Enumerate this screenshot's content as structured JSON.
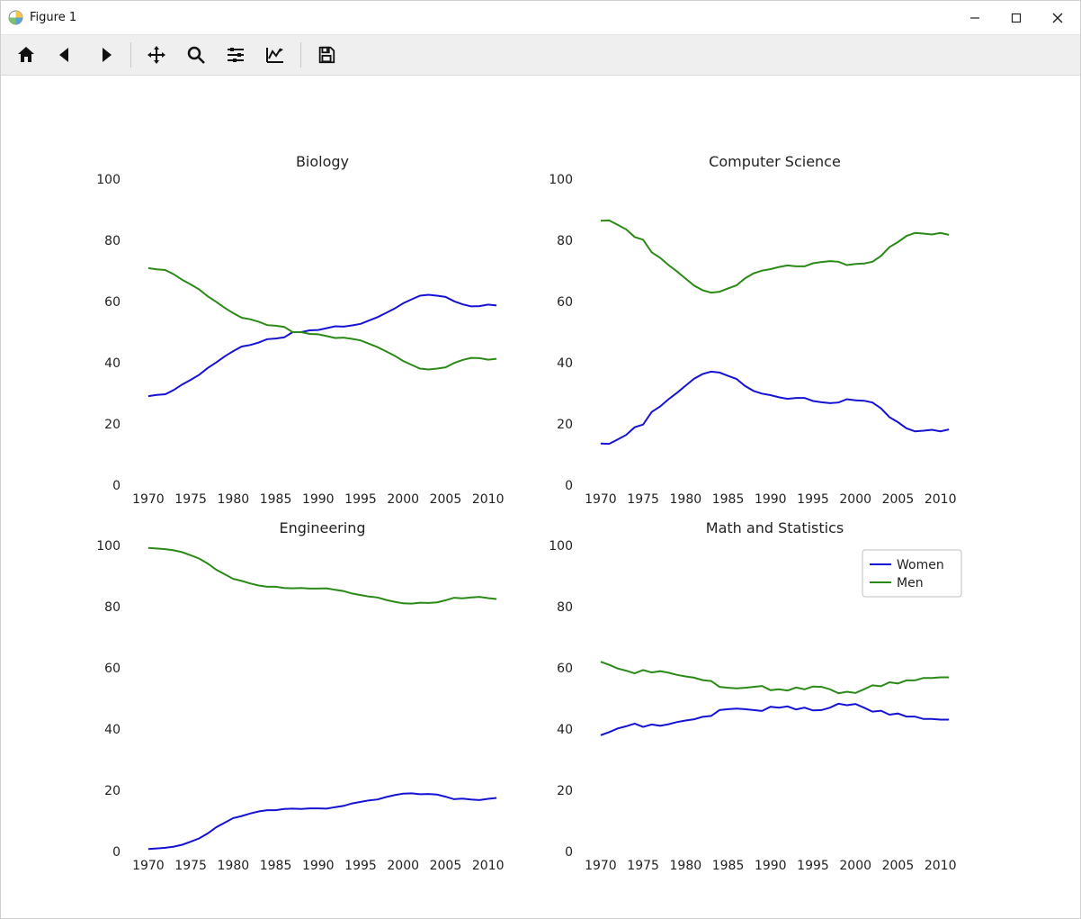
{
  "window": {
    "title": "Figure 1"
  },
  "toolbar": {
    "home": "Home",
    "back": "Back",
    "forward": "Forward",
    "pan": "Pan",
    "zoom": "Zoom",
    "subplots": "Configure subplots",
    "editor": "Edit axis",
    "save": "Save"
  },
  "colors": {
    "women": "#1512d4",
    "men": "#2b8a17"
  },
  "legend": [
    "Women",
    "Men"
  ],
  "chart_data": [
    {
      "type": "line",
      "title": "Biology",
      "xlabel": "",
      "ylabel": "",
      "x_ticks": [
        1970,
        1975,
        1980,
        1985,
        1990,
        1995,
        2000,
        2005,
        2010
      ],
      "y_ticks": [
        0,
        20,
        40,
        60,
        80,
        100
      ],
      "xlim": [
        1968,
        2013
      ],
      "ylim": [
        0,
        100
      ],
      "show_legend": false,
      "x": [
        1970,
        1971,
        1972,
        1973,
        1974,
        1975,
        1976,
        1977,
        1978,
        1979,
        1980,
        1981,
        1982,
        1983,
        1984,
        1985,
        1986,
        1987,
        1988,
        1989,
        1990,
        1991,
        1992,
        1993,
        1994,
        1995,
        1996,
        1997,
        1998,
        1999,
        2000,
        2001,
        2002,
        2003,
        2004,
        2005,
        2006,
        2007,
        2008,
        2009,
        2010,
        2011
      ],
      "series": [
        {
          "name": "Women",
          "color_key": "women",
          "values": [
            29.1,
            29.5,
            29.7,
            31.1,
            32.9,
            34.4,
            36.1,
            38.3,
            40.1,
            42.1,
            43.8,
            45.3,
            45.8,
            46.6,
            47.7,
            47.9,
            48.3,
            50.0,
            50.0,
            50.6,
            50.7,
            51.3,
            51.9,
            51.8,
            52.2,
            52.7,
            53.8,
            54.9,
            56.3,
            57.7,
            59.4,
            60.7,
            61.9,
            62.2,
            61.9,
            61.5,
            60.1,
            59.1,
            58.4,
            58.5,
            59.0,
            58.7
          ]
        },
        {
          "name": "Men",
          "color_key": "men",
          "values": [
            70.9,
            70.5,
            70.3,
            68.9,
            67.1,
            65.6,
            63.9,
            61.7,
            59.9,
            57.9,
            56.2,
            54.7,
            54.2,
            53.4,
            52.3,
            52.1,
            51.7,
            50.0,
            50.0,
            49.4,
            49.3,
            48.7,
            48.1,
            48.2,
            47.8,
            47.3,
            46.2,
            45.1,
            43.7,
            42.3,
            40.6,
            39.3,
            38.1,
            37.8,
            38.1,
            38.5,
            39.9,
            40.9,
            41.6,
            41.5,
            41.0,
            41.3
          ]
        }
      ]
    },
    {
      "type": "line",
      "title": "Computer Science",
      "xlabel": "",
      "ylabel": "",
      "x_ticks": [
        1970,
        1975,
        1980,
        1985,
        1990,
        1995,
        2000,
        2005,
        2010
      ],
      "y_ticks": [
        0,
        20,
        40,
        60,
        80,
        100
      ],
      "xlim": [
        1968,
        2013
      ],
      "ylim": [
        0,
        100
      ],
      "show_legend": false,
      "x": [
        1970,
        1971,
        1972,
        1973,
        1974,
        1975,
        1976,
        1977,
        1978,
        1979,
        1980,
        1981,
        1982,
        1983,
        1984,
        1985,
        1986,
        1987,
        1988,
        1989,
        1990,
        1991,
        1992,
        1993,
        1994,
        1995,
        1996,
        1997,
        1998,
        1999,
        2000,
        2001,
        2002,
        2003,
        2004,
        2005,
        2006,
        2007,
        2008,
        2009,
        2010,
        2011
      ],
      "series": [
        {
          "name": "Women",
          "color_key": "women",
          "values": [
            13.6,
            13.5,
            14.9,
            16.4,
            18.9,
            19.8,
            23.9,
            25.7,
            28.1,
            30.2,
            32.5,
            34.8,
            36.3,
            37.1,
            36.8,
            35.7,
            34.7,
            32.4,
            30.8,
            29.9,
            29.4,
            28.7,
            28.2,
            28.5,
            28.5,
            27.5,
            27.1,
            26.8,
            27.0,
            28.1,
            27.7,
            27.6,
            27.0,
            25.1,
            22.2,
            20.6,
            18.6,
            17.6,
            17.8,
            18.1,
            17.6,
            18.2
          ]
        },
        {
          "name": "Men",
          "color_key": "men",
          "values": [
            86.4,
            86.5,
            85.1,
            83.6,
            81.1,
            80.2,
            76.1,
            74.3,
            71.9,
            69.8,
            67.5,
            65.2,
            63.7,
            62.9,
            63.2,
            64.3,
            65.3,
            67.6,
            69.2,
            70.1,
            70.6,
            71.3,
            71.8,
            71.5,
            71.5,
            72.5,
            72.9,
            73.2,
            73.0,
            71.9,
            72.3,
            72.4,
            73.0,
            74.9,
            77.8,
            79.4,
            81.4,
            82.4,
            82.2,
            81.9,
            82.4,
            81.8
          ]
        }
      ]
    },
    {
      "type": "line",
      "title": "Engineering",
      "xlabel": "",
      "ylabel": "",
      "x_ticks": [
        1970,
        1975,
        1980,
        1985,
        1990,
        1995,
        2000,
        2005,
        2010
      ],
      "y_ticks": [
        0,
        20,
        40,
        60,
        80,
        100
      ],
      "xlim": [
        1968,
        2013
      ],
      "ylim": [
        0,
        100
      ],
      "show_legend": false,
      "x": [
        1970,
        1971,
        1972,
        1973,
        1974,
        1975,
        1976,
        1977,
        1978,
        1979,
        1980,
        1981,
        1982,
        1983,
        1984,
        1985,
        1986,
        1987,
        1988,
        1989,
        1990,
        1991,
        1992,
        1993,
        1994,
        1995,
        1996,
        1997,
        1998,
        1999,
        2000,
        2001,
        2002,
        2003,
        2004,
        2005,
        2006,
        2007,
        2008,
        2009,
        2010,
        2011
      ],
      "series": [
        {
          "name": "Women",
          "color_key": "women",
          "values": [
            0.8,
            1.0,
            1.2,
            1.6,
            2.2,
            3.2,
            4.3,
            5.9,
            7.9,
            9.4,
            10.9,
            11.6,
            12.4,
            13.1,
            13.5,
            13.5,
            13.9,
            14.0,
            13.9,
            14.1,
            14.1,
            14.0,
            14.5,
            14.9,
            15.7,
            16.2,
            16.7,
            17.0,
            17.8,
            18.4,
            18.9,
            19.0,
            18.7,
            18.8,
            18.6,
            17.9,
            17.1,
            17.3,
            17.0,
            16.8,
            17.2,
            17.5
          ]
        },
        {
          "name": "Men",
          "color_key": "men",
          "values": [
            99.2,
            99.0,
            98.8,
            98.4,
            97.8,
            96.8,
            95.7,
            94.1,
            92.1,
            90.6,
            89.1,
            88.4,
            87.6,
            86.9,
            86.5,
            86.5,
            86.1,
            86.0,
            86.1,
            85.9,
            85.9,
            86.0,
            85.5,
            85.1,
            84.3,
            83.8,
            83.3,
            83.0,
            82.2,
            81.6,
            81.1,
            81.0,
            81.3,
            81.2,
            81.4,
            82.1,
            82.9,
            82.7,
            83.0,
            83.2,
            82.8,
            82.5
          ]
        }
      ]
    },
    {
      "type": "line",
      "title": "Math and Statistics",
      "xlabel": "",
      "ylabel": "",
      "x_ticks": [
        1970,
        1975,
        1980,
        1985,
        1990,
        1995,
        2000,
        2005,
        2010
      ],
      "y_ticks": [
        0,
        20,
        40,
        60,
        80,
        100
      ],
      "xlim": [
        1968,
        2013
      ],
      "ylim": [
        0,
        100
      ],
      "show_legend": true,
      "x": [
        1970,
        1971,
        1972,
        1973,
        1974,
        1975,
        1976,
        1977,
        1978,
        1979,
        1980,
        1981,
        1982,
        1983,
        1984,
        1985,
        1986,
        1987,
        1988,
        1989,
        1990,
        1991,
        1992,
        1993,
        1994,
        1995,
        1996,
        1997,
        1998,
        1999,
        2000,
        2001,
        2002,
        2003,
        2004,
        2005,
        2006,
        2007,
        2008,
        2009,
        2010,
        2011
      ],
      "series": [
        {
          "name": "Women",
          "color_key": "women",
          "values": [
            38.0,
            39.0,
            40.2,
            40.9,
            41.8,
            40.7,
            41.5,
            41.1,
            41.6,
            42.3,
            42.8,
            43.2,
            44.0,
            44.3,
            46.2,
            46.5,
            46.7,
            46.5,
            46.2,
            45.9,
            47.3,
            47.0,
            47.4,
            46.4,
            47.0,
            46.1,
            46.2,
            47.0,
            48.3,
            47.8,
            48.2,
            47.0,
            45.7,
            46.0,
            44.7,
            45.1,
            44.1,
            44.1,
            43.3,
            43.3,
            43.1,
            43.1
          ]
        },
        {
          "name": "Men",
          "color_key": "men",
          "values": [
            62.0,
            61.0,
            59.8,
            59.1,
            58.2,
            59.3,
            58.5,
            58.9,
            58.4,
            57.7,
            57.2,
            56.8,
            56.0,
            55.7,
            53.8,
            53.5,
            53.3,
            53.5,
            53.8,
            54.1,
            52.7,
            53.0,
            52.6,
            53.6,
            53.0,
            53.9,
            53.8,
            53.0,
            51.7,
            52.2,
            51.8,
            53.0,
            54.3,
            54.0,
            55.3,
            54.9,
            55.9,
            55.9,
            56.7,
            56.7,
            56.9,
            56.9
          ]
        }
      ]
    }
  ]
}
